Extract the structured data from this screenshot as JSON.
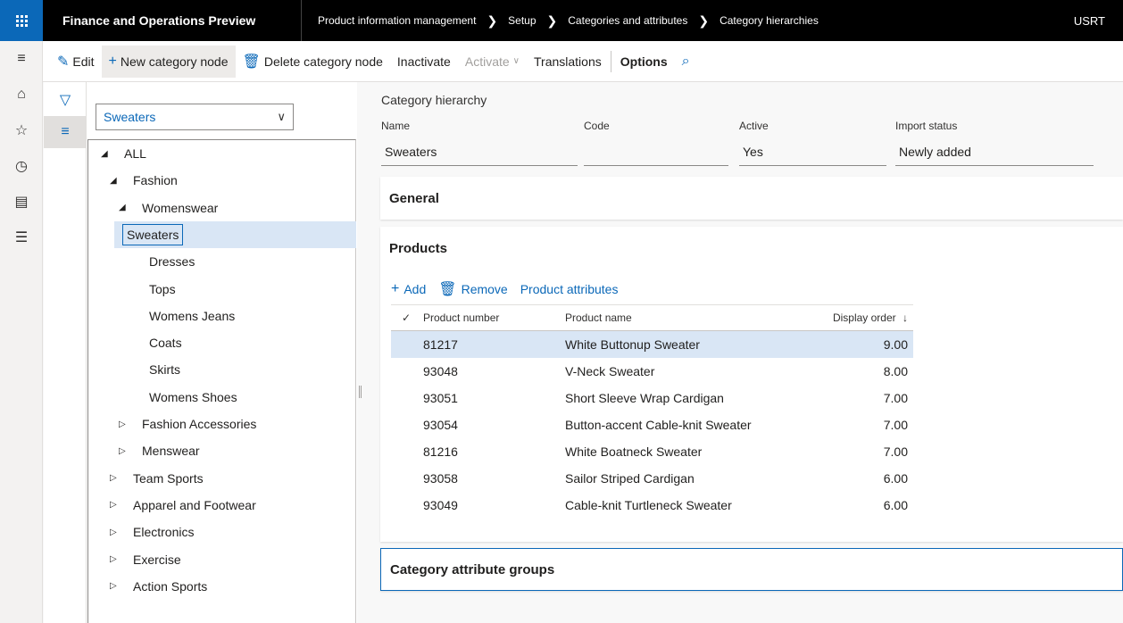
{
  "topbar": {
    "app_title": "Finance and Operations Preview",
    "breadcrumb": [
      "Product information management",
      "Setup",
      "Categories and attributes",
      "Category hierarchies"
    ],
    "user": "USRT"
  },
  "actions": {
    "edit": "Edit",
    "new_node": "New category node",
    "delete_node": "Delete category node",
    "inactivate": "Inactivate",
    "activate": "Activate",
    "translations": "Translations",
    "options": "Options"
  },
  "tree": {
    "selector_value": "Sweaters",
    "nodes": [
      {
        "label": "ALL",
        "indent": 0,
        "expanded": true
      },
      {
        "label": "Fashion",
        "indent": 1,
        "expanded": true
      },
      {
        "label": "Womenswear",
        "indent": 2,
        "expanded": true
      },
      {
        "label": "Sweaters",
        "indent": 3,
        "selected": true
      },
      {
        "label": "Dresses",
        "indent": 3
      },
      {
        "label": "Tops",
        "indent": 3
      },
      {
        "label": "Womens Jeans",
        "indent": 3
      },
      {
        "label": "Coats",
        "indent": 3
      },
      {
        "label": "Skirts",
        "indent": 3
      },
      {
        "label": "Womens Shoes",
        "indent": 3
      },
      {
        "label": "Fashion Accessories",
        "indent": 2,
        "expanded": false
      },
      {
        "label": "Menswear",
        "indent": 2,
        "expanded": false
      },
      {
        "label": "Team Sports",
        "indent": 1,
        "expanded": false
      },
      {
        "label": "Apparel and Footwear",
        "indent": 1,
        "expanded": false
      },
      {
        "label": "Electronics",
        "indent": 1,
        "expanded": false
      },
      {
        "label": "Exercise",
        "indent": 1,
        "expanded": false
      },
      {
        "label": "Action Sports",
        "indent": 1,
        "expanded": false
      }
    ]
  },
  "header": {
    "title": "Category hierarchy",
    "name_label": "Name",
    "name_value": "Sweaters",
    "code_label": "Code",
    "code_value": "",
    "active_label": "Active",
    "active_value": "Yes",
    "import_label": "Import status",
    "import_value": "Newly added"
  },
  "sections": {
    "general": "General",
    "products": "Products",
    "attribute_groups": "Category attribute groups"
  },
  "products_toolbar": {
    "add": "Add",
    "remove": "Remove",
    "attributes": "Product attributes"
  },
  "products_grid": {
    "columns": [
      "Product number",
      "Product name",
      "Display order"
    ],
    "rows": [
      {
        "number": "81217",
        "name": "White Buttonup Sweater",
        "order": "9.00",
        "selected": true
      },
      {
        "number": "93048",
        "name": "V-Neck Sweater",
        "order": "8.00"
      },
      {
        "number": "93051",
        "name": "Short Sleeve Wrap Cardigan",
        "order": "7.00"
      },
      {
        "number": "93054",
        "name": "Button-accent Cable-knit Sweater",
        "order": "7.00"
      },
      {
        "number": "81216",
        "name": "White Boatneck Sweater",
        "order": "7.00"
      },
      {
        "number": "93058",
        "name": "Sailor Striped Cardigan",
        "order": "6.00"
      },
      {
        "number": "93049",
        "name": "Cable-knit Turtleneck Sweater",
        "order": "6.00"
      }
    ]
  },
  "colors": {
    "accent": "#0b68b8",
    "selected_row": "#d9e6f5",
    "topbar": "#000000"
  }
}
